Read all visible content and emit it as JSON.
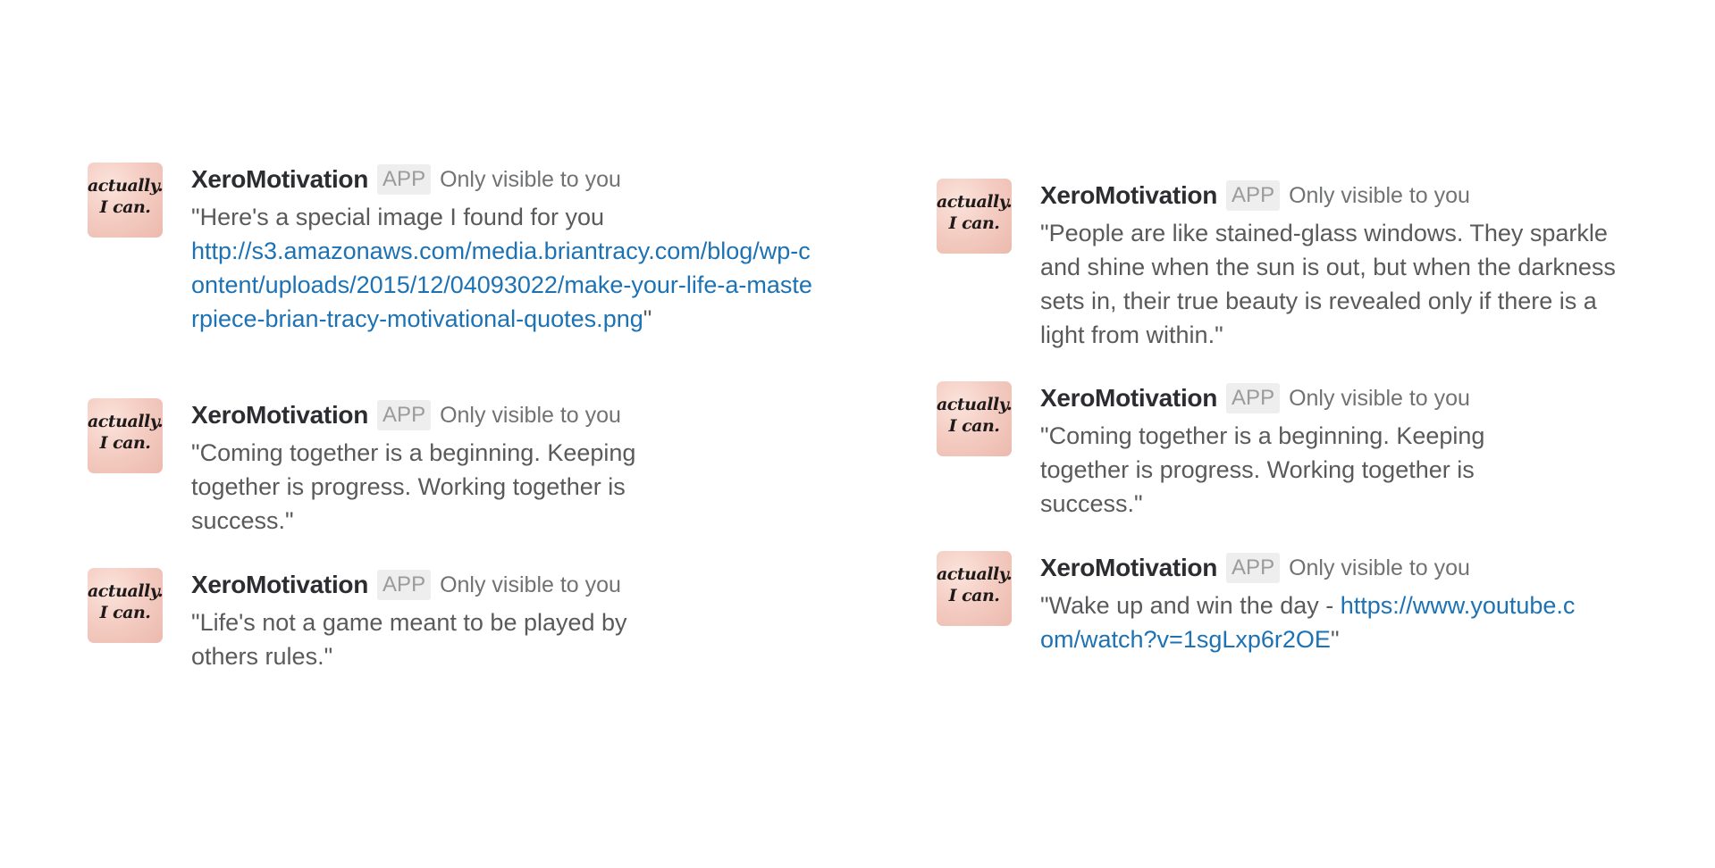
{
  "messages_left": [
    {
      "avatar_text": "actually. I can.",
      "sender": "XeroMotivation",
      "badge": "APP",
      "visibility": "Only visible to you",
      "text_before": "\"Here's a special image I found for you",
      "link": "http://s3.amazonaws.com/media.briantracy.com/blog/wp-content/uploads/2015/12/04093022/make-your-life-a-masterpiece-brian-tracy-motivational-quotes.png",
      "text_after": "\""
    },
    {
      "avatar_text": "actually. I can.",
      "sender": "XeroMotivation",
      "badge": "APP",
      "visibility": "Only visible to you",
      "text": "\"Coming together is a beginning. Keeping together is progress. Working together is success.\""
    },
    {
      "avatar_text": "actually. I can.",
      "sender": "XeroMotivation",
      "badge": "APP",
      "visibility": "Only visible to you",
      "text": "\"Life's not a game meant to be played by others rules.\""
    }
  ],
  "messages_right": [
    {
      "avatar_text": "actually. I can.",
      "sender": "XeroMotivation",
      "badge": "APP",
      "visibility": "Only visible to you",
      "text": "\"People are like stained-glass windows. They sparkle and shine when the sun is out, but when the darkness sets in, their true beauty is revealed only if there is a light from within.\""
    },
    {
      "avatar_text": "actually. I can.",
      "sender": "XeroMotivation",
      "badge": "APP",
      "visibility": "Only visible to you",
      "text": "\"Coming together is a beginning. Keeping together is progress. Working together is success.\""
    },
    {
      "avatar_text": "actually. I can.",
      "sender": "XeroMotivation",
      "badge": "APP",
      "visibility": "Only visible to you",
      "text_before": "\"Wake up and win the day - ",
      "link": "https://www.youtube.com/watch?v=1sgLxp6r2OE",
      "text_after": "\""
    }
  ],
  "colors": {
    "link": "#1d72b4",
    "sender": "#2c2d30",
    "message_text": "#5a5a5c",
    "badge_bg": "#eeeeee",
    "avatar_bg": "#f4cdc3"
  }
}
